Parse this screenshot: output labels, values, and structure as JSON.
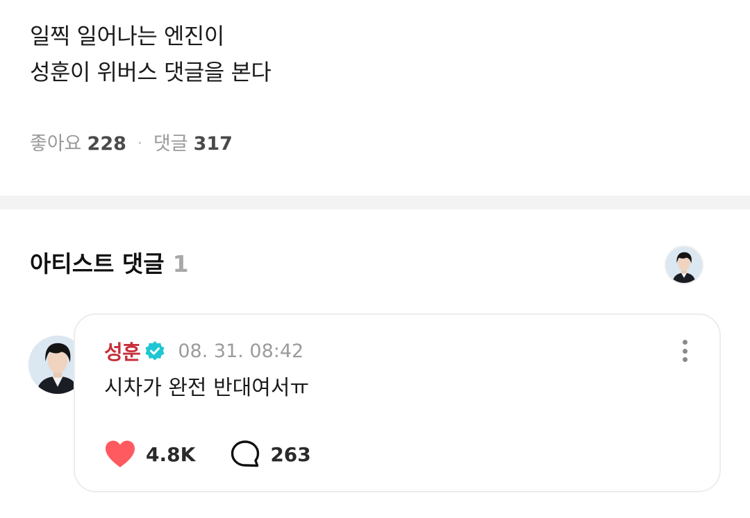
{
  "post": {
    "lines": [
      "일찍 일어나는 엔진이",
      "성훈이 위버스 댓글을 본다"
    ]
  },
  "stats": {
    "likes_label": "좋아요",
    "likes_count": "228",
    "separator": "·",
    "comments_label": "댓글",
    "comments_count": "317"
  },
  "artist_comments": {
    "title": "아티스트 댓글",
    "count": "1"
  },
  "comment": {
    "author": "성훈",
    "timestamp": "08. 31. 08:42",
    "text": "시차가 완전 반대여서ㅠ",
    "likes": "4.8K",
    "replies": "263"
  },
  "colors": {
    "author": "#c62f3a",
    "verified": "#1fc7d4",
    "heart": "#ff5a5f",
    "divider": "#f3f3f3"
  },
  "icons": [
    "verified-badge-icon",
    "more-options-icon",
    "heart-icon",
    "reply-bubble-icon"
  ]
}
